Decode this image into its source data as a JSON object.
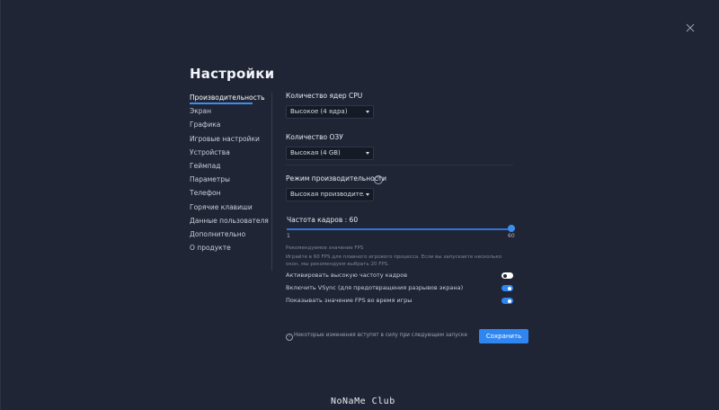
{
  "page": {
    "title": "Настройки",
    "save_label": "Сохранить",
    "notice": "Некоторые изменения вступят в силу при следующем запуске",
    "watermark": "NoNaMe Club"
  },
  "sidebar": {
    "items": [
      {
        "label": "Производительность",
        "active": true
      },
      {
        "label": "Экран"
      },
      {
        "label": "Графика"
      },
      {
        "label": "Игровые настройки"
      },
      {
        "label": "Устройства"
      },
      {
        "label": "Геймпад"
      },
      {
        "label": "Параметры"
      },
      {
        "label": "Телефон"
      },
      {
        "label": "Горячие клавиши"
      },
      {
        "label": "Данные пользователя"
      },
      {
        "label": "Дополнительно"
      },
      {
        "label": "О продукте"
      }
    ]
  },
  "cpu": {
    "label": "Количество ядер CPU",
    "value": "Высокое (4 ядра)"
  },
  "ram": {
    "label": "Количество ОЗУ",
    "value": "Высокая (4 GB)"
  },
  "mode": {
    "label": "Режим производительности",
    "value": "Высокая производител"
  },
  "fps": {
    "label": "Частота кадров : 60",
    "min": "1",
    "max": "60",
    "value": 60,
    "hint_title": "Рекомендуемое значение FPS",
    "hint_text": "Играйте в 60 FPS для плавного игрового процесса. Если вы запускаете несколько окон, мы рекомендуем выбрать 20 FPS."
  },
  "toggles": [
    {
      "label": "Активировать высокую частоту кадров",
      "on": false
    },
    {
      "label": "Включить VSync (для предотвращения разрывов экрана)",
      "on": true
    },
    {
      "label": "Показывать значение FPS во время игры",
      "on": true
    }
  ],
  "colors": {
    "accent": "#2f86f0",
    "background": "#1f2535"
  },
  "icons": {
    "close": "close-icon",
    "help": "help-icon",
    "info": "info-icon",
    "caret": "chevron-down-icon"
  }
}
